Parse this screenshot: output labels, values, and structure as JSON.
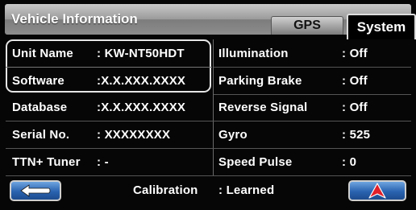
{
  "header": {
    "title": "Vehicle Information"
  },
  "tabs": [
    {
      "label": "GPS",
      "active": false
    },
    {
      "label": "System",
      "active": true
    }
  ],
  "left_rows": [
    {
      "label": "Unit Name",
      "value": ": KW-NT50HDT"
    },
    {
      "label": "Software",
      "value": ":X.X.XXX.XXXX"
    },
    {
      "label": "Database",
      "value": ":X.X.XXX.XXXX"
    },
    {
      "label": "Serial No.",
      "value": ": XXXXXXXX"
    },
    {
      "label": "TTN+ Tuner",
      "value": ": -"
    }
  ],
  "right_rows": [
    {
      "label": "Illumination",
      "value": ": Off"
    },
    {
      "label": "Parking Brake",
      "value": ": Off"
    },
    {
      "label": "Reverse Signal",
      "value": ": Off"
    },
    {
      "label": "Gyro",
      "value": ": 525"
    },
    {
      "label": "Speed Pulse",
      "value": ": 0"
    }
  ],
  "bottom": {
    "calibration_label": "Calibration",
    "calibration_value": ": Learned"
  },
  "icons": {
    "back": "back-arrow-icon",
    "map": "navigation-arrow-icon"
  },
  "colors": {
    "button_blue": "#2a63b0",
    "arrow_red": "#e0202a"
  }
}
